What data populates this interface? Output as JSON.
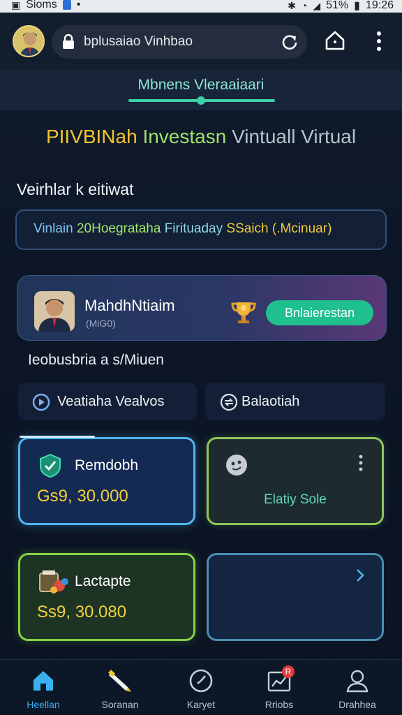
{
  "status_bar": {
    "carrier": "Sioms",
    "battery": "51%",
    "time": "19:26"
  },
  "browser": {
    "url": "bplusaiao Vinhbao"
  },
  "tab": {
    "label": "Mbnens Vleraaiaari"
  },
  "headline": {
    "part1": "PIIVBINah",
    "part2": "Investasn",
    "part3": "Vintuall Virtual"
  },
  "subheading": "Veirhlar k eitiwat",
  "info_box": {
    "seg1": "Vinlain",
    "seg2": "20Hoegrataha",
    "seg3": "Firituaday",
    "seg4": "SSaich (.Mcinuar)"
  },
  "profile": {
    "name": "MahdhNtiaim",
    "sub": "(MiG0)",
    "cta": "Bnlaierestan"
  },
  "section_text": "Ieobusbria a s/Miuen",
  "pills": [
    {
      "label": "Veatiaha Vealvos",
      "icon": "play-circle-icon"
    },
    {
      "label": "Balaotiah",
      "icon": "swap-circle-icon"
    }
  ],
  "cards": {
    "card1": {
      "title": "Remdobh",
      "value": "Gs9, 30.000"
    },
    "card2": {
      "label": "Elatiy Sole"
    },
    "card3": {
      "title": "Lactapte",
      "value": "Ss9, 30.080"
    }
  },
  "bottom_nav": [
    {
      "label": "Heellan",
      "icon": "home-icon",
      "active": true
    },
    {
      "label": "Soranan",
      "icon": "pencil-icon",
      "active": false
    },
    {
      "label": "Karyet",
      "icon": "clock-icon",
      "active": false
    },
    {
      "label": "Rriobs",
      "icon": "chart-icon",
      "active": false,
      "badge": "R"
    },
    {
      "label": "Drahhea",
      "icon": "person-icon",
      "active": false
    }
  ],
  "colors": {
    "accent_teal": "#3dcfa8",
    "accent_yellow": "#f2c430",
    "accent_blue": "#3ab0ef",
    "accent_green": "#87d14a"
  }
}
